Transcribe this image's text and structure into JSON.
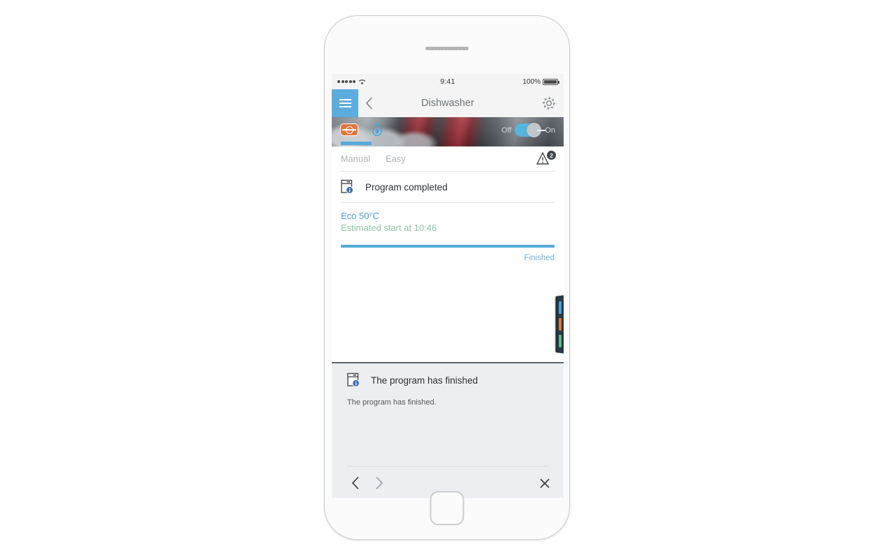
{
  "status_bar": {
    "signal_icon": "signal-dots-icon",
    "wifi_icon": "wifi-icon",
    "time": "9:41",
    "battery_percent": "100%",
    "battery_icon": "battery-full-icon"
  },
  "nav": {
    "menu_icon": "hamburger-menu-icon",
    "back_icon": "chevron-left-icon",
    "title": "Dishwasher",
    "settings_icon": "gear-icon"
  },
  "hero": {
    "salt_icon": "salt-refill-icon",
    "rinse_aid_icon": "water-drop-icon",
    "power_off_label": "Off",
    "power_on_label": "On",
    "power_state": "on",
    "toggle_icon": "power-toggle-switch"
  },
  "tabs": {
    "items": [
      {
        "label": "Manual",
        "active": true
      },
      {
        "label": "Easy",
        "active": false
      }
    ],
    "warning_icon": "warning-triangle-icon",
    "warning_count": "2"
  },
  "status": {
    "icon": "dishwasher-info-icon",
    "label": "Program completed"
  },
  "program": {
    "name": "Eco 50°C",
    "estimate": "Estimated start at 10:46",
    "progress_percent": 100,
    "state_label": "Finished"
  },
  "drawer": {
    "name": "color-indicator-drawer",
    "bars": [
      "#4aa3dc",
      "#e2763c",
      "#5fbd86"
    ]
  },
  "notification_panel": {
    "icon": "dishwasher-info-icon",
    "title": "The program has finished",
    "body": "The program has finished.",
    "prev_icon": "chevron-left-icon",
    "next_icon": "chevron-right-icon",
    "close_icon": "close-x-icon",
    "footer_icon": "dishwasher-info-icon"
  },
  "colors": {
    "accent_blue": "#56a9d9",
    "menu_blue": "#5cadde",
    "program_blue": "#4b9cd3",
    "estimate_green": "#8cc4a4",
    "salt_orange": "#e2733d",
    "panel_bg": "#eceef1"
  }
}
